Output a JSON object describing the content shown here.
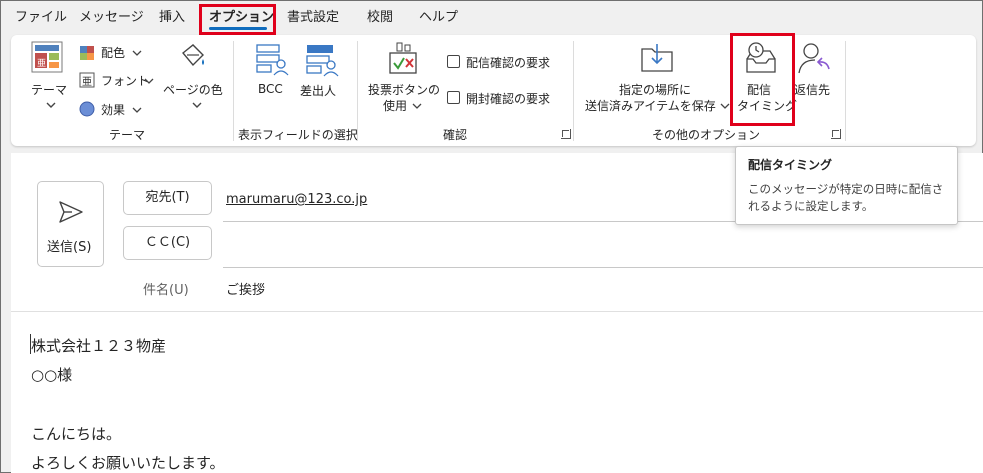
{
  "menu": {
    "tabs": [
      {
        "label": "ファイル"
      },
      {
        "label": "メッセージ"
      },
      {
        "label": "挿入"
      },
      {
        "label": "オプション",
        "active": true
      },
      {
        "label": "書式設定"
      },
      {
        "label": "校閲"
      },
      {
        "label": "ヘルプ"
      }
    ]
  },
  "ribbon": {
    "theme_group": {
      "label": "テーマ",
      "theme_button": "テーマ",
      "colors": "配色",
      "fonts": "フォント",
      "effects": "効果",
      "page_color": "ページの色"
    },
    "fields_group": {
      "label": "表示フィールドの選択",
      "bcc": "BCC",
      "from": "差出人"
    },
    "tracking_group": {
      "label": "確認",
      "voting_line1": "投票ボタンの",
      "voting_line2": "使用",
      "delivery_receipt": "配信確認の要求",
      "read_receipt": "開封確認の要求"
    },
    "more_options_group": {
      "label": "その他のオプション",
      "save_sent_line1": "指定の場所に",
      "save_sent_line2": "送信済みアイテムを保存",
      "delay_line1": "配信",
      "delay_line2": "タイミング",
      "reply_to": "返信先"
    }
  },
  "tooltip": {
    "title": "配信タイミング",
    "body": "このメッセージが特定の日時に配信されるように設定します。"
  },
  "compose": {
    "send_label": "送信(S)",
    "to_label": "宛先(T)",
    "to_value": "marumaru@123.co.jp",
    "cc_label": "ＣＣ(C)",
    "subject_label": "件名(U)",
    "subject_value": "ご挨拶",
    "body_lines": [
      "株式会社１２３物産",
      "○○様",
      "",
      "こんにちは。",
      "よろしくお願いいたします。"
    ]
  },
  "colors": {
    "accent": "#0f6cbd",
    "highlight": "#e0001b"
  }
}
